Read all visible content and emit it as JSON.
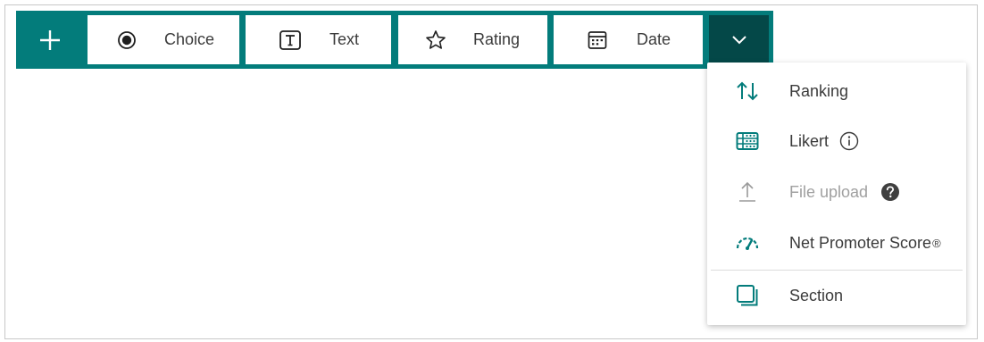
{
  "toolbar": {
    "add_icon": "plus-icon",
    "buttons": [
      {
        "label": "Choice",
        "icon": "radio-icon"
      },
      {
        "label": "Text",
        "icon": "text-icon"
      },
      {
        "label": "Rating",
        "icon": "star-icon"
      },
      {
        "label": "Date",
        "icon": "calendar-icon"
      }
    ],
    "more_icon": "chevron-down-icon"
  },
  "dropdown": {
    "items": [
      {
        "label": "Ranking",
        "icon": "sort-arrows-icon"
      },
      {
        "label": "Likert",
        "icon": "likert-grid-icon",
        "suffix_icon": "info-icon"
      },
      {
        "label": "File upload",
        "icon": "upload-icon",
        "suffix_icon": "help-icon",
        "disabled": true
      },
      {
        "label": "Net Promoter Score",
        "suffix": "®",
        "icon": "gauge-icon"
      },
      {
        "label": "Section",
        "icon": "section-icon"
      }
    ]
  },
  "colors": {
    "toolbar_bg": "#037c7b",
    "more_button_bg": "#044848",
    "accent": "#037c7b",
    "text": "#3b3b3b",
    "disabled_text": "#a0a0a0"
  }
}
